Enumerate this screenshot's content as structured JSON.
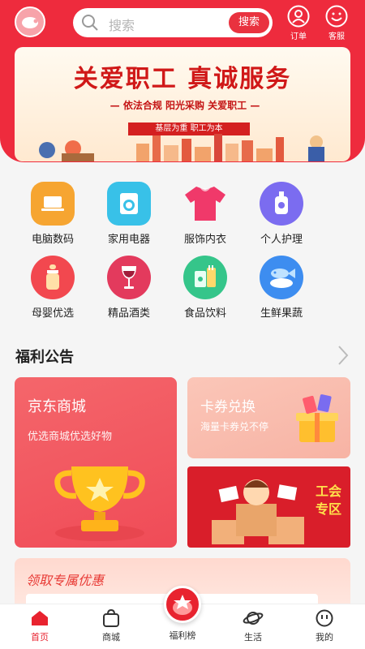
{
  "header": {
    "search_placeholder": "搜索",
    "search_button": "搜索",
    "orders_label": "订单",
    "service_label": "客服"
  },
  "banner": {
    "title": "关爱职工 真诚服务",
    "slogans": "— 依法合规   阳光采购   关爱职工 —",
    "tagline": "基层为重   职工为本"
  },
  "categories": [
    {
      "label": "电脑数码",
      "icon": "laptop-icon",
      "color": "#f6a531"
    },
    {
      "label": "家用电器",
      "icon": "washer-icon",
      "color": "#38c1e8"
    },
    {
      "label": "服饰内衣",
      "icon": "tshirt-icon",
      "color": "#f0396a"
    },
    {
      "label": "个人护理",
      "icon": "bottle-icon",
      "color": "#7b6cf0"
    },
    {
      "label": "母婴优选",
      "icon": "baby-bottle-icon",
      "color": "#f2484f"
    },
    {
      "label": "精品酒类",
      "icon": "wine-glass-icon",
      "color": "#e33a5d"
    },
    {
      "label": "食品饮料",
      "icon": "food-icon",
      "color": "#35c58a"
    },
    {
      "label": "生鲜果蔬",
      "icon": "fish-icon",
      "color": "#3d8df0"
    }
  ],
  "welfare": {
    "section_title": "福利公告",
    "jd_title": "京东商城",
    "jd_subtitle": "优选商城优选好物",
    "coupon_title": "卡券兑换",
    "coupon_subtitle": "海量卡券兑不停",
    "union_title": "工会专区",
    "exclusive_title": "领取专属优惠"
  },
  "tabbar": {
    "home": "首页",
    "mall": "商城",
    "ranking": "福利榜",
    "life": "生活",
    "mine": "我的"
  },
  "colors": {
    "brand": "#ee2b3d",
    "active": "#e8232f"
  }
}
